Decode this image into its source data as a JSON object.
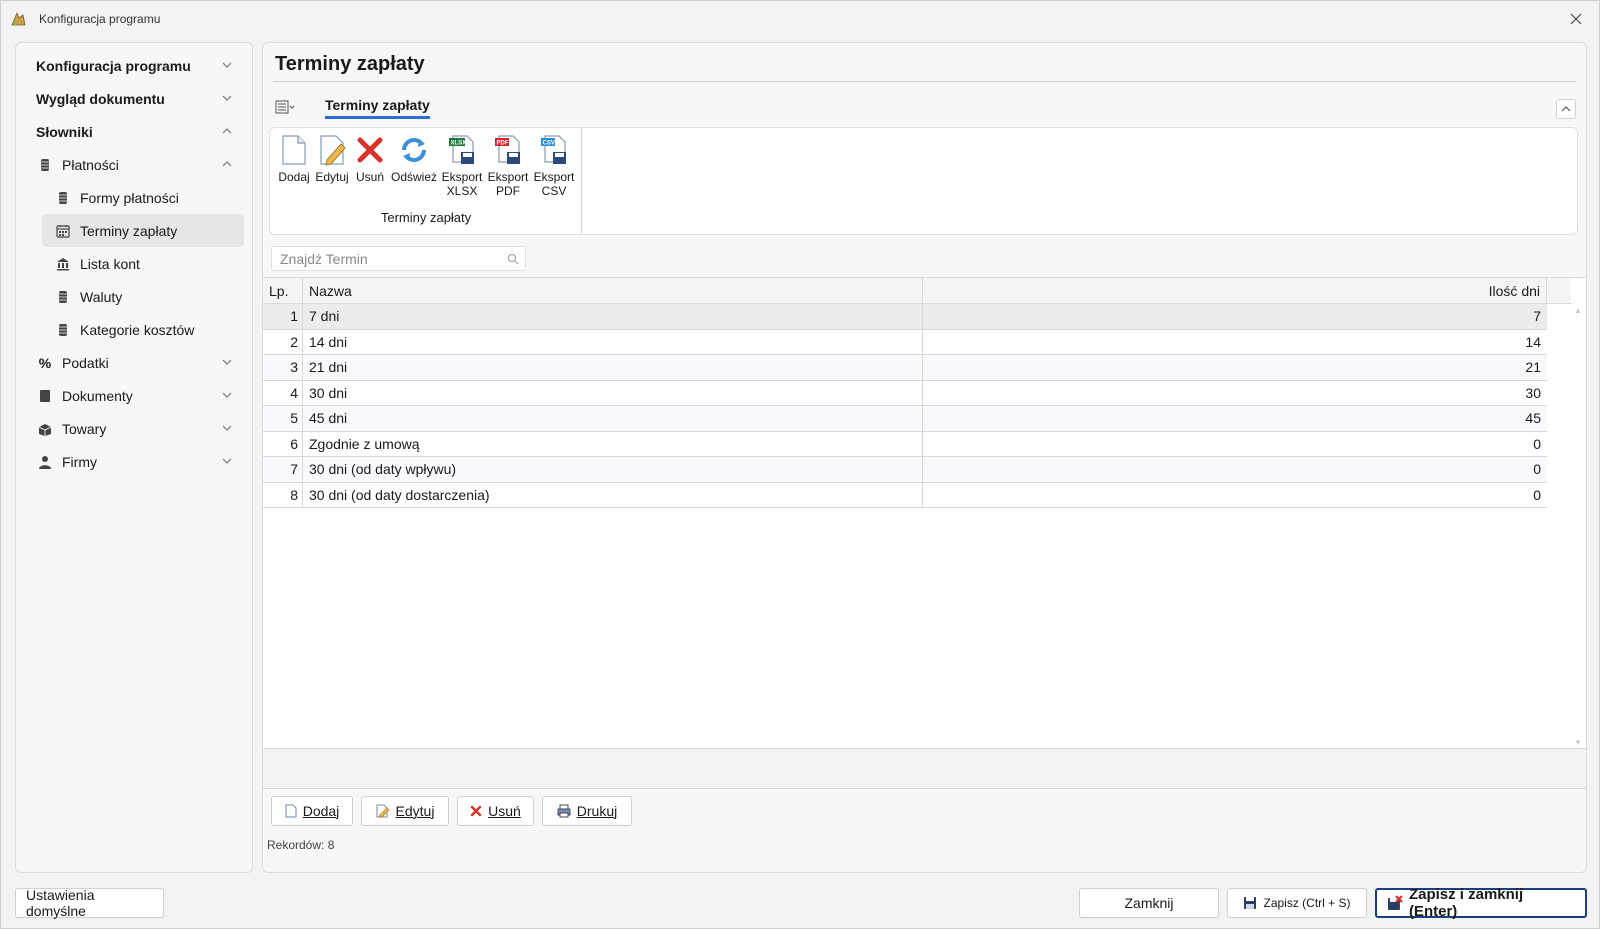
{
  "window": {
    "title": "Konfiguracja programu"
  },
  "sidebar": {
    "items": [
      {
        "label": "Konfiguracja programu",
        "level": "group",
        "chevron": "down"
      },
      {
        "label": "Wygląd dokumentu",
        "level": "group",
        "chevron": "down"
      },
      {
        "label": "Słowniki",
        "level": "group",
        "chevron": "up"
      },
      {
        "label": "Płatności",
        "level": "l1",
        "chevron": "up",
        "icon": "cylinder-icon"
      },
      {
        "label": "Formy płatności",
        "level": "l2",
        "icon": "cylinder-icon"
      },
      {
        "label": "Terminy zapłaty",
        "level": "l2",
        "icon": "calendar-icon",
        "active": true
      },
      {
        "label": "Lista kont",
        "level": "l2",
        "icon": "bank-icon"
      },
      {
        "label": "Waluty",
        "level": "l2",
        "icon": "cylinder-icon"
      },
      {
        "label": "Kategorie kosztów",
        "level": "l2",
        "icon": "cylinder-icon"
      },
      {
        "label": "Podatki",
        "level": "l1",
        "chevron": "down",
        "icon": "percent-icon"
      },
      {
        "label": "Dokumenty",
        "level": "l1",
        "chevron": "down",
        "icon": "document-icon"
      },
      {
        "label": "Towary",
        "level": "l1",
        "chevron": "down",
        "icon": "box-icon"
      },
      {
        "label": "Firmy",
        "level": "l1",
        "chevron": "down",
        "icon": "person-icon"
      }
    ]
  },
  "main": {
    "page_title": "Terminy zapłaty",
    "ribbon_tab": "Terminy zapłaty",
    "ribbon_group_label": "Terminy zapłaty",
    "ribbon_buttons": {
      "add": "Dodaj",
      "edit": "Edytuj",
      "delete": "Usuń",
      "refresh": "Odśwież",
      "export_xlsx": "Eksport XLSX",
      "export_pdf": "Eksport PDF",
      "export_csv": "Eksport CSV"
    },
    "search": {
      "placeholder": "Znajdź Termin",
      "value": ""
    },
    "table": {
      "headers": {
        "lp": "Lp.",
        "name": "Nazwa",
        "days": "Ilość dni"
      },
      "rows": [
        {
          "lp": "1",
          "name": "7 dni",
          "days": "7"
        },
        {
          "lp": "2",
          "name": "14 dni",
          "days": "14"
        },
        {
          "lp": "3",
          "name": "21 dni",
          "days": "21"
        },
        {
          "lp": "4",
          "name": "30 dni",
          "days": "30"
        },
        {
          "lp": "5",
          "name": "45 dni",
          "days": "45"
        },
        {
          "lp": "6",
          "name": "Zgodnie z umową",
          "days": "0"
        },
        {
          "lp": "7",
          "name": "30 dni (od daty wpływu)",
          "days": "0"
        },
        {
          "lp": "8",
          "name": "30 dni (od daty dostarczenia)",
          "days": "0"
        }
      ]
    },
    "bottom_buttons": {
      "add": "Dodaj",
      "edit": "Edytuj",
      "delete": "Usuń",
      "print": "Drukuj"
    },
    "records": "Rekordów: 8"
  },
  "footer": {
    "defaults": "Ustawienia domyślne",
    "close": "Zamknij",
    "save": "Zapisz (Ctrl + S)",
    "save_close": "Zapisz i zamknij (Enter)"
  },
  "colors": {
    "accent": "#2b6ed6",
    "primary_border": "#1a3f7a",
    "delete_red": "#d9312b"
  }
}
